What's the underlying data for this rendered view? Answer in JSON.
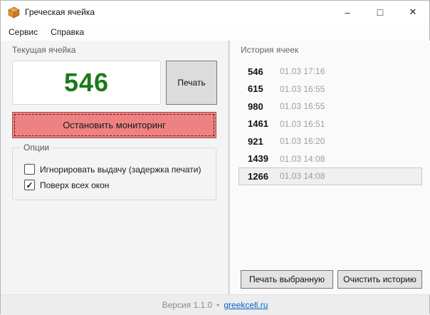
{
  "window": {
    "title": "Греческая ячейка",
    "controls": {
      "minimize": "–",
      "maximize": "□",
      "close": "✕"
    }
  },
  "menu": {
    "items": [
      {
        "label": "Сервис"
      },
      {
        "label": "Справка"
      }
    ]
  },
  "current_cell": {
    "group_label": "Текущая ячейка",
    "value": "546",
    "print_button": "Печать",
    "stop_button": "Остановить мониторинг"
  },
  "options": {
    "group_label": "Опции",
    "checkboxes": [
      {
        "label": "Игнорировать выдачу (задержка печати)",
        "checked": false
      },
      {
        "label": "Поверх всех окон",
        "checked": true
      }
    ]
  },
  "history": {
    "title": "История ячеек",
    "items": [
      {
        "value": "546",
        "time": "01.03 17:16",
        "selected": false
      },
      {
        "value": "615",
        "time": "01.03 16:55",
        "selected": false
      },
      {
        "value": "980",
        "time": "01.03 16:55",
        "selected": false
      },
      {
        "value": "1461",
        "time": "01.03 16:51",
        "selected": false
      },
      {
        "value": "921",
        "time": "01.03 16:20",
        "selected": false
      },
      {
        "value": "1439",
        "time": "01.03 14:08",
        "selected": false
      },
      {
        "value": "1266",
        "time": "01.03 14:08",
        "selected": true
      }
    ],
    "print_selected_button": "Печать выбранную",
    "clear_button": "Очистить историю"
  },
  "status_bar": {
    "version": "Версия 1.1.0",
    "separator": "•",
    "link": "greekcell.ru"
  },
  "icons": {
    "app_icon": "package-box",
    "check_glyph": "✓"
  },
  "colors": {
    "cell_value_green": "#1b7a1b",
    "stop_button_red": "#ee8181",
    "stop_button_border": "#a94a4a",
    "link_blue": "#0563c1",
    "left_panel_bg": "#f4f4f4",
    "right_panel_bg": "#fafafa"
  }
}
